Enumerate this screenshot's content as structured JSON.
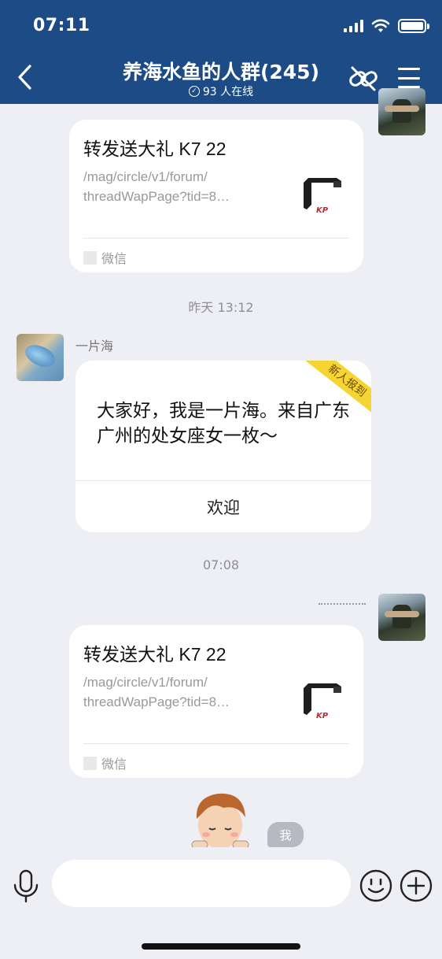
{
  "status_bar": {
    "time": "07:11"
  },
  "nav": {
    "title": "养海水鱼的人群(245)",
    "online": "93 人在线"
  },
  "messages": {
    "link_card_1": {
      "title": "转发送大礼 K7 22",
      "desc_line1": "/mag/circle/v1/forum/",
      "desc_line2": "threadWapPage?tid=8…",
      "source": "微信"
    },
    "time_1": "昨天 13:12",
    "welcome": {
      "sender": "一片海",
      "ribbon": "新人报到",
      "text": "大家好，我是一片海。来自广东广州的处女座女一枚～",
      "button": "欢迎"
    },
    "time_2": "07:08",
    "link_card_2": {
      "title": "转发送大礼 K7 22",
      "desc_line1": "/mag/circle/v1/forum/",
      "desc_line2": "threadWapPage?tid=8…",
      "source": "微信"
    },
    "me_badge": "我"
  },
  "composer": {
    "placeholder": ""
  },
  "icons": {
    "back": "chevron-left-icon",
    "link": "link-off-icon",
    "menu": "hamburger-menu-icon",
    "mic": "microphone-icon",
    "emoji": "smiley-icon",
    "plus": "plus-circle-icon"
  },
  "colors": {
    "header": "#1d4b86",
    "background": "#eeeff4",
    "ribbon": "#f6d533"
  }
}
